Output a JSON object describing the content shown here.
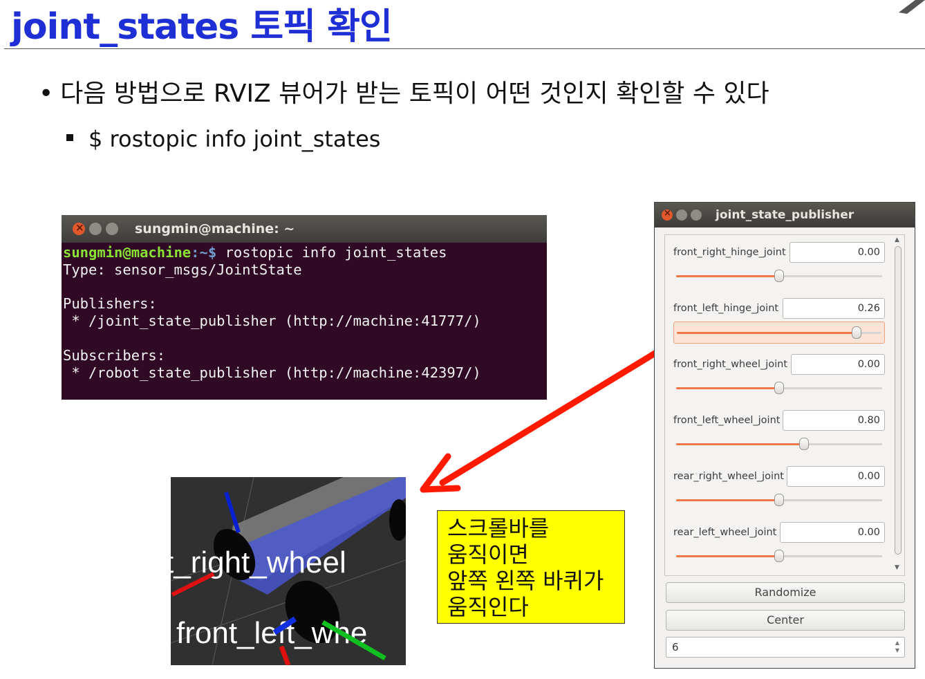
{
  "slide": {
    "title": "joint_states 토픽 확인",
    "bullet1": "다음 방법으로 RVIZ 뷰어가 받는 토픽이 어떤 것인지 확인할 수 있다",
    "bullet2": "$ rostopic info joint_states"
  },
  "terminal": {
    "title": "sungmin@machine: ~",
    "prompt_user": "sungmin@machine",
    "prompt_path": ":~$",
    "command": " rostopic info joint_states",
    "lines": [
      "Type: sensor_msgs/JointState",
      "",
      "Publishers:",
      " * /joint_state_publisher (http://machine:41777/)",
      "",
      "Subscribers:",
      " * /robot_state_publisher (http://machine:42397/)"
    ]
  },
  "rviz": {
    "label_top": "t_right_wheel",
    "label_bottom": "front_left_whe"
  },
  "note": {
    "lines": [
      "스크롤바를",
      "움직이면",
      "앞쪽 왼쪽 바퀴가",
      "움직인다"
    ]
  },
  "joint_state_publisher": {
    "title": "joint_state_publisher",
    "joints": [
      {
        "name": "front_right_hinge_joint",
        "value": "0.00",
        "position": 0.5
      },
      {
        "name": "front_left_hinge_joint",
        "value": "0.26",
        "position": 0.88
      },
      {
        "name": "front_right_wheel_joint",
        "value": "0.00",
        "position": 0.5
      },
      {
        "name": "front_left_wheel_joint",
        "value": "0.80",
        "position": 0.62
      },
      {
        "name": "rear_right_wheel_joint",
        "value": "0.00",
        "position": 0.5
      },
      {
        "name": "rear_left_wheel_joint",
        "value": "0.00",
        "position": 0.5
      }
    ],
    "randomize_label": "Randomize",
    "center_label": "Center",
    "spin_value": "6"
  },
  "colors": {
    "title": "#1f2fd6",
    "terminal_bg": "#300a24",
    "arrow": "#ff1a00",
    "note_bg": "#ffff00",
    "slider_fill": "#f07746"
  }
}
